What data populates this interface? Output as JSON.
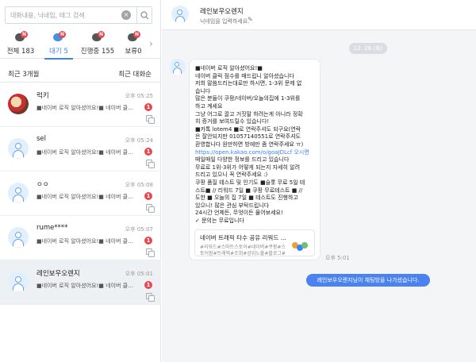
{
  "search": {
    "placeholder": "대화내용, 닉네임, 태그 검색"
  },
  "tabs": [
    {
      "label": "전체 183"
    },
    {
      "label": "대기 5"
    },
    {
      "label": "진행중 155"
    },
    {
      "label": "보류0"
    }
  ],
  "sort": {
    "period": "최근 3개월",
    "order": "최근 대화순"
  },
  "conversations": [
    {
      "name": "럭키",
      "time": "오후 05:25",
      "preview": "■네이버 로직 알아셨어요!■ 네이버 클릭 점수■",
      "badge": "1"
    },
    {
      "name": "sel",
      "time": "오후 05:24",
      "preview": "■네이버 로직 알아셨어요!■ 네이버 클릭 점수■",
      "badge": "1"
    },
    {
      "name": "ㅇㅇ",
      "time": "오후 05:08",
      "preview": "■네이버 로직 알아셨어요!■ 네이버 클릭 점수■",
      "badge": "1"
    },
    {
      "name": "rume****",
      "time": "오후 05:07",
      "preview": "■네이버 로직 알아셨어요!■ 네이버 클릭 점수■",
      "badge": "1"
    },
    {
      "name": "레인보우오렌지",
      "time": "오후 05:01",
      "preview": "■네이버 로직 알아셨어요!■ 네이버 클릭 점수■",
      "badge": "1"
    }
  ],
  "chat": {
    "title": "레인보우오렌지",
    "nickname_placeholder": "닉네임을 입력하세요.",
    "date": "12. 26.(화)",
    "message_lines": [
      "■네이버 로직 알아셨어요!■",
      "네이버 클릭 점수를 매드립니 알아셨습니다",
      "저희 말씀드리는대로만 하시면, 1-3위 문제 없",
      "습니다",
      "많은 분들이 쿠팡/네이버/오늘의집에 1-3위를",
      "하고 계세요",
      "그냥 어그로 끌고 거짓말 하려는게 아니라 정확",
      "히 증거를 보여드릴수 있습니다!",
      "■카톡 lotem4 ■로 연락주셔도 되구요(연락",
      "은 잘안되지만 01057140551로 연락주셔도",
      "환영합니다 원만하면 방에만 좀 연락주세요 ㅠ)",
      "https://open.kakao.com/o/goaJDLcf 오시면",
      "매일매일 다양한 정보를 드리고 있습니다",
      "무료로 1위-3위가 어떻게 되는지 자세히 알려",
      "드리고 있으니 꼭 연락주세요 :)",
      "쿠팡 품질 테스트 및 인기도 ■슬롯 무료 5일 테",
      "스트■ // 리워드 7일 ■ 쿠팡 무료테스트 ■ //",
      "도한 ■ 오늘의 집 7일 ■ 테스트도 진행하고",
      "있으니! 많은 관심 부탁드립니다",
      "24시간 언제든, 무엇이든 물어보세요!",
      "✓ 문의는 무료입니다"
    ],
    "link_line_index": 11,
    "card": {
      "title": "네이버 트래픽 타수 공유 리워드 ...",
      "desc1": "#리워드#스마트스토어#네이버#쿠팡#스",
      "desc2": "토어팜#트래픽#조회#상위노출#블로그#"
    },
    "message_time": "오후 5:01",
    "system_message": "레인보우오렌지님이 채팅방을 나가셨습니다."
  }
}
